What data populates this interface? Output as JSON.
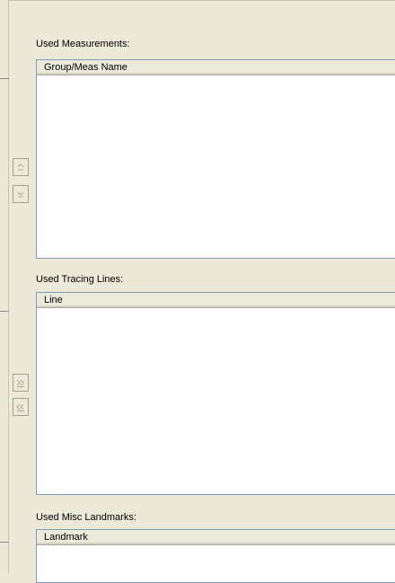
{
  "sections": {
    "measurements": {
      "label": "Used Measurements:",
      "column": "Group/Meas Name"
    },
    "tracing_lines": {
      "label": "Used Tracing Lines:",
      "column": "Line"
    },
    "misc_landmarks": {
      "label": "Used Misc Landmarks:",
      "column": "Landmark"
    }
  },
  "buttons": {
    "move_up_icon": "caret-up-icon",
    "move_down_icon": "caret-down-icon",
    "add_icon": "double-chevron-right-icon",
    "remove_icon": "double-chevron-left-icon"
  },
  "colors": {
    "panel_bg": "#ece9d8",
    "list_border": "#7f9db9",
    "disabled_glyph": "#aca899"
  }
}
